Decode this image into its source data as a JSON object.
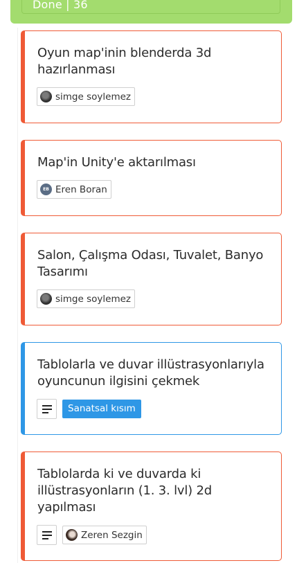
{
  "column": {
    "title": "Done  |  36",
    "color": "#a3dc6e"
  },
  "cards": [
    {
      "title": "Oyun map'inin blenderda 3d hazırlanması",
      "accent": "#ef5a36",
      "assignee": {
        "name": "simge soylemez",
        "avatar": "photo"
      }
    },
    {
      "title": "Map'in Unity'e aktarılması",
      "accent": "#ef5a36",
      "assignee": {
        "name": "Eren Boran",
        "avatar_initials": "EB"
      }
    },
    {
      "title": "Salon, Çalışma Odası, Tuvalet, Banyo Tasarımı",
      "accent": "#ef5a36",
      "assignee": {
        "name": "simge soylemez",
        "avatar": "photo"
      }
    },
    {
      "title": "Tablolarla ve duvar illüstrasyonlarıyla oyuncunun ilgisini çekmek",
      "accent": "#2e97e6",
      "has_description": true,
      "label": {
        "text": "Sanatsal kısım",
        "color": "#2e97e6"
      }
    },
    {
      "title": "Tablolarda ki ve duvarda ki illüstrasyonların (1. 3. lvl) 2d yapılması",
      "accent": "#ef5a36",
      "has_description": true,
      "assignee": {
        "name": "Zeren Sezgin",
        "avatar": "photo"
      }
    }
  ],
  "icons": {
    "description": "description-lines-icon"
  }
}
